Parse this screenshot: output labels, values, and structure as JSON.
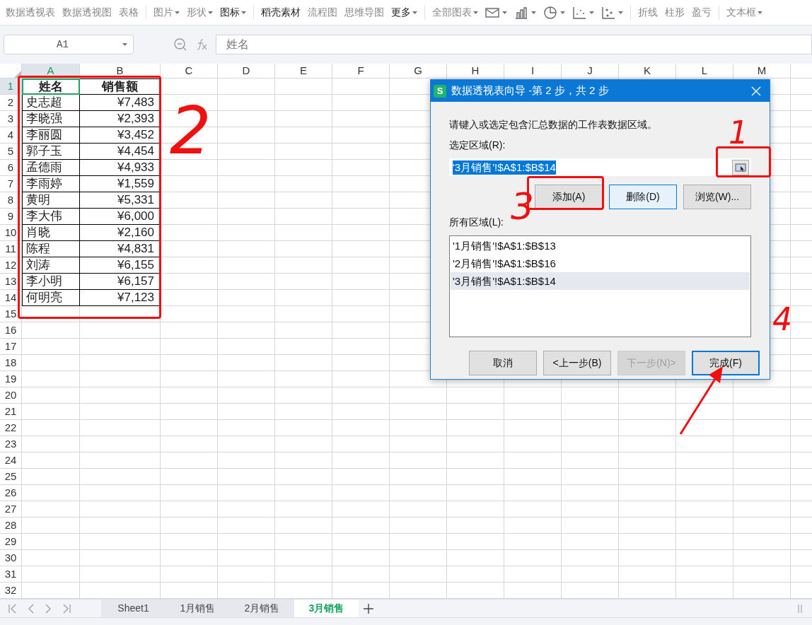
{
  "toolbar": {
    "groups": [
      {
        "items": [
          {
            "kind": "text",
            "label": "数据透视表",
            "dropdown": false,
            "strong": false
          },
          {
            "kind": "text",
            "label": "数据透视图",
            "dropdown": false,
            "strong": false
          },
          {
            "kind": "text",
            "label": "表格",
            "dropdown": false,
            "strong": false
          }
        ]
      },
      {
        "items": [
          {
            "kind": "text",
            "label": "图片",
            "dropdown": true,
            "strong": false
          },
          {
            "kind": "text",
            "label": "形状",
            "dropdown": true,
            "strong": false
          },
          {
            "kind": "text",
            "label": "图标",
            "dropdown": true,
            "strong": true
          }
        ]
      },
      {
        "items": [
          {
            "kind": "text",
            "label": "稻壳素材",
            "dropdown": false,
            "strong": true
          },
          {
            "kind": "text",
            "label": "流程图",
            "dropdown": false,
            "strong": false
          },
          {
            "kind": "text",
            "label": "思维导图",
            "dropdown": false,
            "strong": false
          },
          {
            "kind": "text",
            "label": "更多",
            "dropdown": true,
            "strong": true
          }
        ]
      },
      {
        "items": [
          {
            "kind": "text",
            "label": "全部图表",
            "dropdown": true,
            "strong": false
          },
          {
            "kind": "icon",
            "dropdown": true
          },
          {
            "kind": "icon",
            "dropdown": true
          },
          {
            "kind": "icon",
            "dropdown": true
          },
          {
            "kind": "icon",
            "dropdown": true
          },
          {
            "kind": "icon",
            "dropdown": true
          }
        ]
      },
      {
        "items": [
          {
            "kind": "text",
            "label": "折线",
            "dropdown": false,
            "strong": false
          },
          {
            "kind": "text",
            "label": "柱形",
            "dropdown": false,
            "strong": false
          },
          {
            "kind": "text",
            "label": "盈亏",
            "dropdown": false,
            "strong": false
          }
        ]
      },
      {
        "items": [
          {
            "kind": "text",
            "label": "文本框",
            "dropdown": true,
            "strong": false
          }
        ]
      }
    ]
  },
  "formula_bar": {
    "name_box": "A1",
    "formula": "姓名"
  },
  "sheet": {
    "columns": [
      {
        "label": "A",
        "selected": true
      },
      {
        "label": "B",
        "selected": false
      },
      {
        "label": "C",
        "selected": false
      },
      {
        "label": "D",
        "selected": false
      },
      {
        "label": "E",
        "selected": false
      },
      {
        "label": "F",
        "selected": false
      },
      {
        "label": "G",
        "selected": false
      },
      {
        "label": "H",
        "selected": false
      },
      {
        "label": "I",
        "selected": false
      },
      {
        "label": "J",
        "selected": false
      },
      {
        "label": "K",
        "selected": false
      },
      {
        "label": "L",
        "selected": false
      },
      {
        "label": "M",
        "selected": false
      }
    ],
    "row_numbers": [
      "1",
      "2",
      "3",
      "4",
      "5",
      "6",
      "7",
      "8",
      "9",
      "10",
      "11",
      "12",
      "13",
      "14",
      "15",
      "16",
      "17",
      "18",
      "19",
      "20",
      "21",
      "22",
      "23",
      "24",
      "25",
      "26",
      "27",
      "28",
      "29",
      "30",
      "31",
      "32"
    ],
    "rows": [
      {
        "selected": true,
        "cells": [
          {
            "text": "姓名",
            "kind": "header",
            "selected": true
          },
          {
            "text": "销售额",
            "kind": "header",
            "selected": false
          }
        ]
      },
      {
        "selected": false,
        "cells": [
          {
            "text": "史志超",
            "kind": "text",
            "selected": false
          },
          {
            "text": "¥7,483",
            "kind": "number",
            "selected": false
          }
        ]
      },
      {
        "selected": false,
        "cells": [
          {
            "text": "李晓强",
            "kind": "text",
            "selected": false
          },
          {
            "text": "¥2,393",
            "kind": "number",
            "selected": false
          }
        ]
      },
      {
        "selected": false,
        "cells": [
          {
            "text": "李丽圆",
            "kind": "text",
            "selected": false
          },
          {
            "text": "¥3,452",
            "kind": "number",
            "selected": false
          }
        ]
      },
      {
        "selected": false,
        "cells": [
          {
            "text": "郭子玉",
            "kind": "text",
            "selected": false
          },
          {
            "text": "¥4,454",
            "kind": "number",
            "selected": false
          }
        ]
      },
      {
        "selected": false,
        "cells": [
          {
            "text": "孟德雨",
            "kind": "text",
            "selected": false
          },
          {
            "text": "¥4,933",
            "kind": "number",
            "selected": false
          }
        ]
      },
      {
        "selected": false,
        "cells": [
          {
            "text": "李雨婷",
            "kind": "text",
            "selected": false
          },
          {
            "text": "¥1,559",
            "kind": "number",
            "selected": false
          }
        ]
      },
      {
        "selected": false,
        "cells": [
          {
            "text": "黄明",
            "kind": "text",
            "selected": false
          },
          {
            "text": "¥5,331",
            "kind": "number",
            "selected": false
          }
        ]
      },
      {
        "selected": false,
        "cells": [
          {
            "text": "李大伟",
            "kind": "text",
            "selected": false
          },
          {
            "text": "¥6,000",
            "kind": "number",
            "selected": false
          }
        ]
      },
      {
        "selected": false,
        "cells": [
          {
            "text": "肖晓",
            "kind": "text",
            "selected": false
          },
          {
            "text": "¥2,160",
            "kind": "number",
            "selected": false
          }
        ]
      },
      {
        "selected": false,
        "cells": [
          {
            "text": "陈程",
            "kind": "text",
            "selected": false
          },
          {
            "text": "¥4,831",
            "kind": "number",
            "selected": false
          }
        ]
      },
      {
        "selected": false,
        "cells": [
          {
            "text": "刘涛",
            "kind": "text",
            "selected": false
          },
          {
            "text": "¥6,155",
            "kind": "number",
            "selected": false
          }
        ]
      },
      {
        "selected": false,
        "cells": [
          {
            "text": "李小明",
            "kind": "text",
            "selected": false
          },
          {
            "text": "¥6,157",
            "kind": "number",
            "selected": false
          }
        ]
      },
      {
        "selected": false,
        "cells": [
          {
            "text": "何明亮",
            "kind": "text",
            "selected": false
          },
          {
            "text": "¥7,123",
            "kind": "number",
            "selected": false
          }
        ]
      }
    ]
  },
  "dialog": {
    "title": "数据透视表向导 -第 2 步，共 2 步",
    "app_badge": "S",
    "prompt": "请键入或选定包含汇总数据的工作表数据区域。",
    "range_label": "选定区域(R):",
    "range_value": "'3月销售'!$A$1:$B$14",
    "range_buttons": [
      {
        "label": "添加(A)",
        "focused": false
      },
      {
        "label": "删除(D)",
        "focused": true
      },
      {
        "label": "浏览(W)...",
        "focused": false
      }
    ],
    "list_label": "所有区域(L):",
    "ranges": [
      {
        "text": "'1月销售'!$A$1:$B$13",
        "selected": false
      },
      {
        "text": "'2月销售'!$A$1:$B$16",
        "selected": false
      },
      {
        "text": "'3月销售'!$A$1:$B$14",
        "selected": true
      }
    ],
    "footer_buttons": [
      {
        "label": "取消",
        "disabled": false,
        "default": false
      },
      {
        "label": "<上一步(B)",
        "disabled": false,
        "default": false
      },
      {
        "label": "下一步(N)>",
        "disabled": true,
        "default": false
      },
      {
        "label": "完成(F)",
        "disabled": false,
        "default": true
      }
    ]
  },
  "sheet_tabs": [
    {
      "label": "Sheet1",
      "selected": false
    },
    {
      "label": "1月销售",
      "selected": false
    },
    {
      "label": "2月销售",
      "selected": false
    },
    {
      "label": "3月销售",
      "selected": true
    }
  ],
  "annotations": [
    {
      "label": "1"
    },
    {
      "label": "2"
    },
    {
      "label": "3"
    },
    {
      "label": "4"
    }
  ]
}
